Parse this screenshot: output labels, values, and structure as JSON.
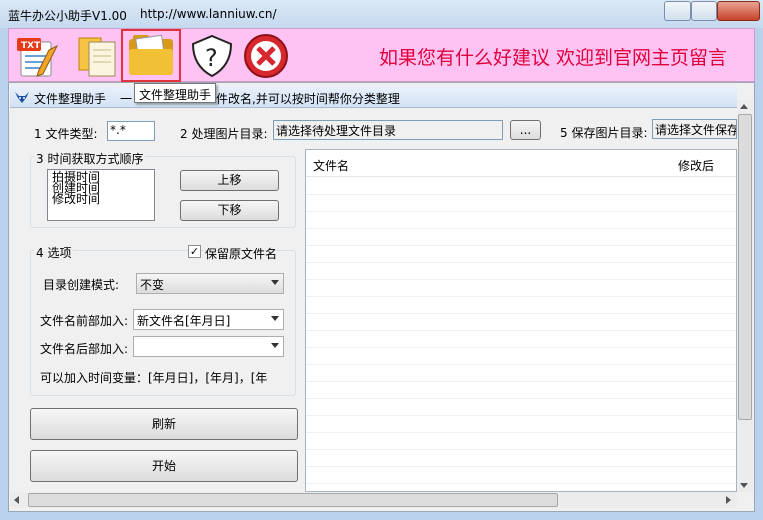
{
  "window": {
    "title": "蓝牛办公小助手V1.00",
    "url": "http://www.lanniuw.cn/"
  },
  "toolbar": {
    "slogan": "如果您有什么好建议 欢迎到官网主页留言",
    "buttons": [
      {
        "icon": "txt-notepad-icon"
      },
      {
        "icon": "documents-icon"
      },
      {
        "icon": "folder-icon",
        "tooltip": "文件整理助手",
        "selected": true
      },
      {
        "icon": "help-shield-icon"
      },
      {
        "icon": "close-red-icon"
      }
    ]
  },
  "tab": {
    "title": "文件整理助手",
    "description_prefix": "一",
    "description": "件改名,并可以按时间帮你分类整理"
  },
  "form": {
    "file_type_label": "1 文件类型:",
    "file_type_value": "*.*",
    "src_dir_label": "2 处理图片目录:",
    "src_dir_value": "请选择待处理文件目录",
    "browse_label": "...",
    "dst_dir_label": "5 保存图片目录:",
    "dst_dir_value": "请选择文件保存",
    "time_group_label": "3 时间获取方式顺序",
    "time_order": [
      "拍摄时间",
      "创建时间",
      "修改时间"
    ],
    "up_label": "上移",
    "down_label": "下移",
    "options_label": "4 选项",
    "keep_name_label": "保留原文件名",
    "keep_name_checked": true,
    "dir_mode_label": "目录创建模式:",
    "dir_mode_value": "不变",
    "prefix_label": "文件名前部加入:",
    "prefix_value": "新文件名[年月日]",
    "suffix_label": "文件名后部加入:",
    "suffix_value": "",
    "vars_hint": "可以加入时间变量：[年月日]，[年月]，[年",
    "refresh_label": "刷新",
    "start_label": "开始"
  },
  "file_list": {
    "columns": [
      "文件名",
      "修改后"
    ]
  },
  "colors": {
    "toolbar_bg": "#ffc3f3",
    "slogan": "#e0003c",
    "accent": "#2b5797"
  }
}
